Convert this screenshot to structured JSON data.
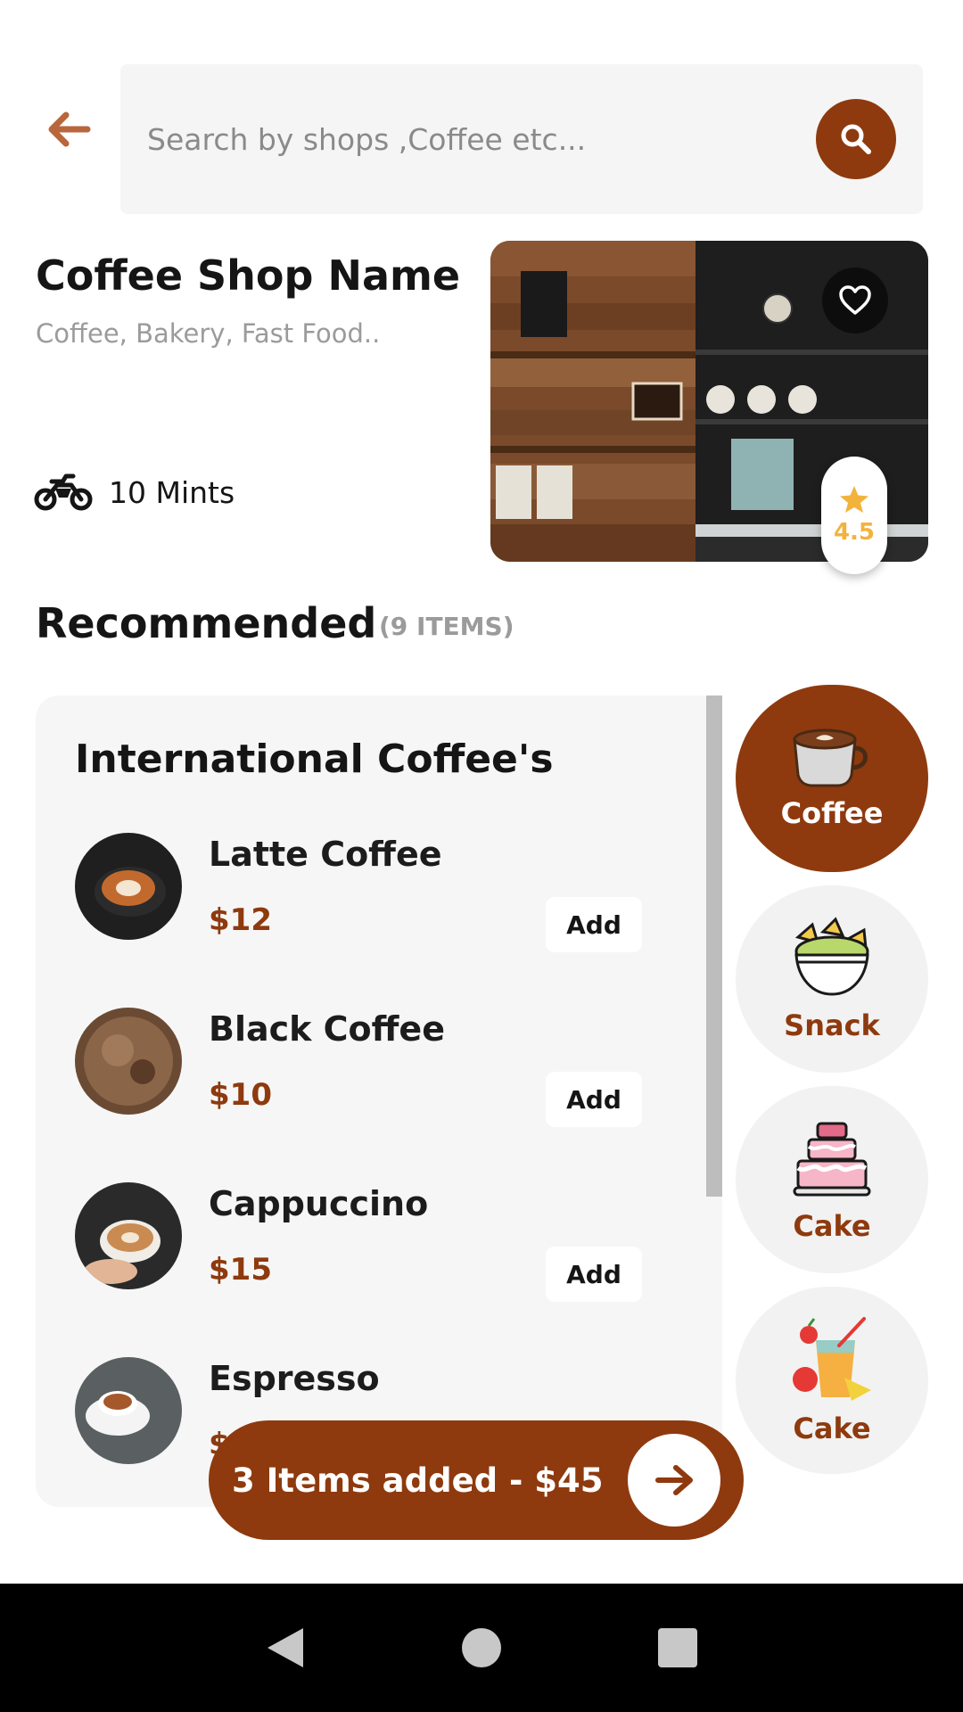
{
  "search": {
    "placeholder": "Search by shops ,Coffee etc..."
  },
  "shop": {
    "name": "Coffee Shop Name",
    "tags": "Coffee, Bakery, Fast Food..",
    "delivery_time": "10 Mints",
    "rating": "4.5"
  },
  "recommended": {
    "title": "Recommended",
    "count": "(9 ITEMS)"
  },
  "menu": {
    "section_title": "International Coffee's",
    "items": [
      {
        "name": "Latte Coffee",
        "price": "$12",
        "add_label": "Add"
      },
      {
        "name": "Black Coffee",
        "price": "$10",
        "add_label": "Add"
      },
      {
        "name": "Cappuccino",
        "price": "$15",
        "add_label": "Add"
      },
      {
        "name": "Espresso",
        "price": "$"
      }
    ]
  },
  "cart": {
    "summary": "3 Items added - $45"
  },
  "categories": [
    {
      "label": "Coffee",
      "icon": "coffee-cup-icon",
      "active": true
    },
    {
      "label": "Snack",
      "icon": "nachos-bowl-icon",
      "active": false
    },
    {
      "label": "Cake",
      "icon": "cake-icon",
      "active": false
    },
    {
      "label": "Cake",
      "icon": "juice-fruit-icon",
      "active": false
    }
  ],
  "colors": {
    "accent": "#8e3a0e",
    "panel": "#f6f6f6",
    "rating": "#f2b33d"
  }
}
